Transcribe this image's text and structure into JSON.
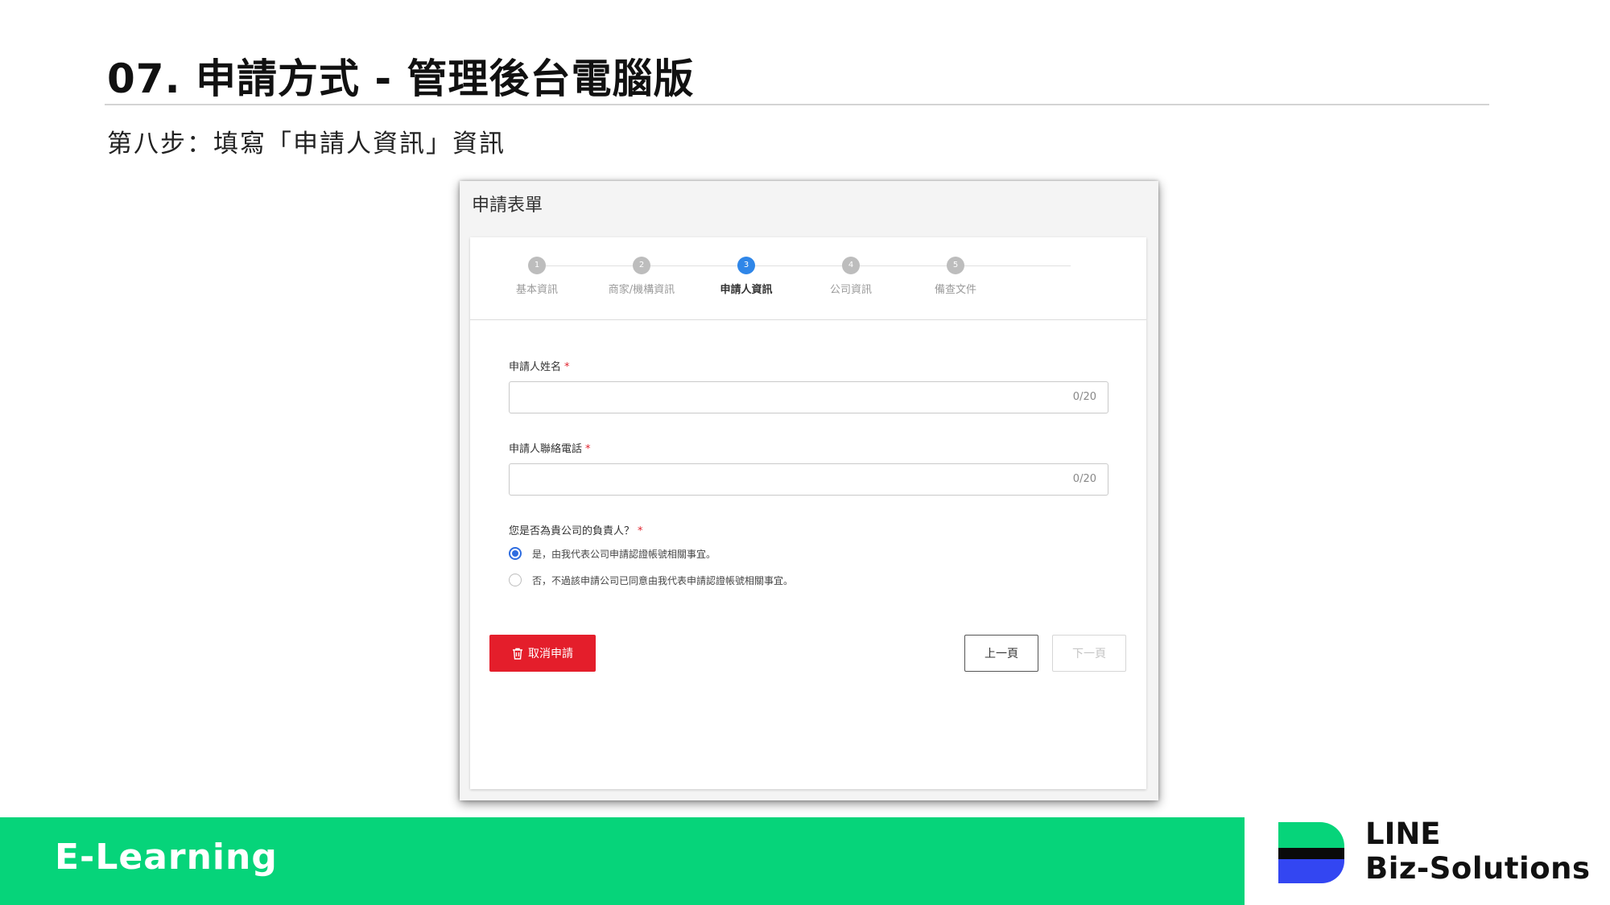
{
  "slide": {
    "title": "07. 申請方式 - 管理後台電腦版",
    "subtitle": "第八步：填寫「申請人資訊」資訊"
  },
  "form": {
    "window_title": "申請表單",
    "steps": [
      {
        "number": "1",
        "label": "基本資訊",
        "state": "inactive"
      },
      {
        "number": "2",
        "label": "商家/機構資訊",
        "state": "inactive"
      },
      {
        "number": "3",
        "label": "申請人資訊",
        "state": "active"
      },
      {
        "number": "4",
        "label": "公司資訊",
        "state": "inactive"
      },
      {
        "number": "5",
        "label": "備查文件",
        "state": "inactive"
      }
    ],
    "name_field": {
      "label": "申請人姓名",
      "required_mark": "*",
      "value": "",
      "counter": "0/20"
    },
    "phone_field": {
      "label": "申請人聯絡電話",
      "required_mark": "*",
      "value": "",
      "counter": "0/20"
    },
    "responsible_question": {
      "label": "您是否為貴公司的負責人？",
      "required_mark": "*",
      "options": [
        {
          "text": "是，由我代表公司申請認證帳號相關事宜。",
          "checked": true
        },
        {
          "text": "否，不過該申請公司已同意由我代表申請認證帳號相關事宜。",
          "checked": false
        }
      ]
    },
    "buttons": {
      "cancel_label": "取消申請",
      "prev_label": "上一頁",
      "next_label": "下一頁"
    }
  },
  "footer": {
    "label": "E-Learning",
    "logo_line1": "LINE",
    "logo_line2": "Biz-Solutions"
  },
  "colors": {
    "accent_green": "#06d47a",
    "step_active": "#2f86e8",
    "radio_checked": "#2f6de0",
    "cancel_red": "#e41e2b",
    "logo_blue": "#3346f2"
  }
}
